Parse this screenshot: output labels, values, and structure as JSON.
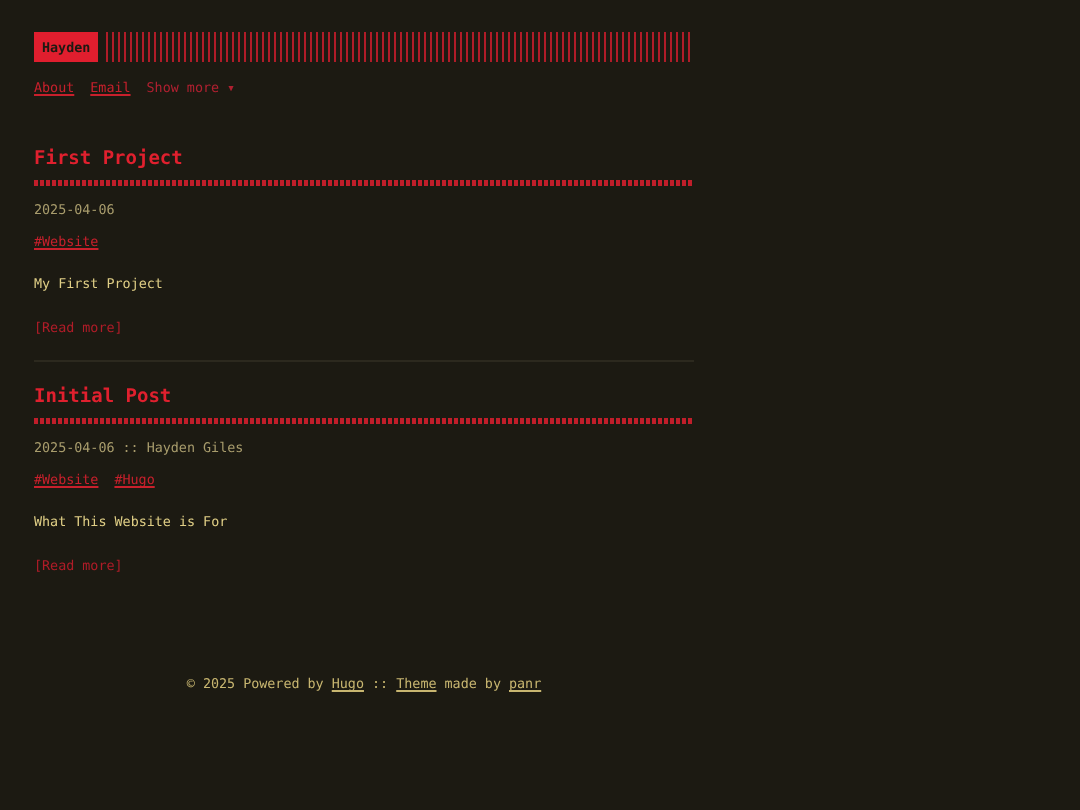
{
  "header": {
    "logo": "Hayden",
    "menu": [
      {
        "label": "About"
      },
      {
        "label": "Email"
      }
    ],
    "more": "Show more ▾"
  },
  "posts": [
    {
      "title": "First Project",
      "date": "2025-04-06",
      "tags": [
        "#Website"
      ],
      "summary": "My First Project",
      "read_more": "[Read more]"
    },
    {
      "title": "Initial Post",
      "date": "2025-04-06",
      "separator": "::",
      "author": "Hayden Giles",
      "tags": [
        "#Website",
        "#Hugo"
      ],
      "summary": "What This Website is For",
      "read_more": "[Read more]"
    }
  ],
  "footer": {
    "parts": [
      {
        "kind": "text",
        "text": "© 2025 Powered by"
      },
      {
        "kind": "link",
        "text": "Hugo"
      },
      {
        "kind": "text",
        "text": "::"
      },
      {
        "kind": "link",
        "text": "Theme"
      },
      {
        "kind": "text",
        "text": "made by"
      },
      {
        "kind": "link",
        "text": "panr"
      }
    ]
  }
}
